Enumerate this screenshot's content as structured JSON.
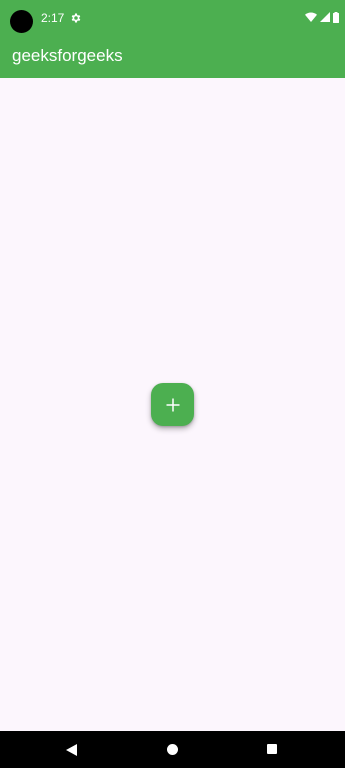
{
  "status_bar": {
    "time": "2:17",
    "icons": [
      "settings-icon",
      "wifi-icon",
      "signal-icon",
      "battery-icon"
    ]
  },
  "app_bar": {
    "title": "geeksforgeeks"
  },
  "fab": {
    "icon": "plus-icon"
  },
  "nav_bar": {
    "icons": [
      "back-icon",
      "home-icon",
      "recents-icon"
    ]
  },
  "colors": {
    "primary": "#4caf50",
    "background": "#fcf6fd",
    "nav_bar": "#000000",
    "on_primary": "#ffffff"
  }
}
